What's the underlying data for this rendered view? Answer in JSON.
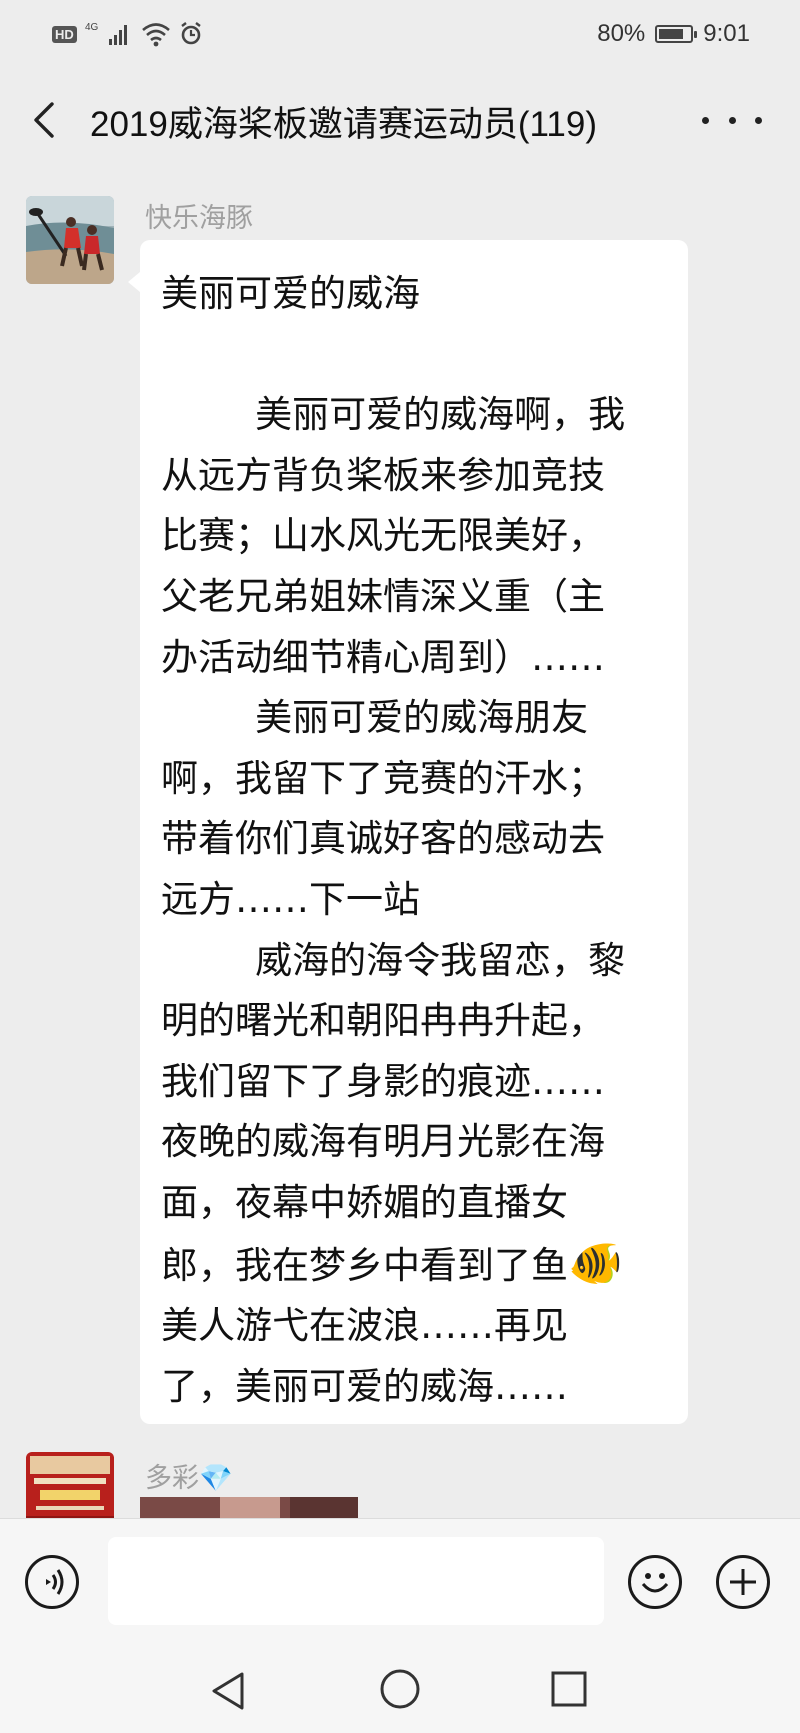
{
  "status_bar": {
    "hd_badge": "HD",
    "network": "4G",
    "battery_level": "80%",
    "battery_fraction": 0.8,
    "time": "9:01"
  },
  "header": {
    "title": "2019威海桨板邀请赛运动员(119)",
    "back_icon": "chevron-left-icon",
    "more_icon": "more-dots-icon"
  },
  "messages": [
    {
      "sender": "快乐海豚",
      "text_before": "美丽可爱的威海\n\n        美丽可爱的威海啊，我从远方背负桨板来参加竞技比赛；山水风光无限美好，父老兄弟姐妹情深义重（主办活动细节精心周到）……\n        美丽可爱的威海朋友啊，我留下了竞赛的汗水；带着你们真诚好客的感动去远方……下一站\n        威海的海令我留恋，黎明的曙光和朝阳冉冉升起，我们留下了身影的痕迹……夜晚的威海有明月光影在海面，夜幕中娇媚的直播女郎，我在梦乡中看到了鱼",
      "emoji": "🐠",
      "text_after": "美人游弋在波浪……再见了，美丽可爱的威海……"
    },
    {
      "sender": "多彩",
      "sender_emoji": "💎"
    }
  ],
  "input_bar": {
    "voice_icon": "voice-icon",
    "emoji_icon": "smiley-icon",
    "add_icon": "plus-icon",
    "input_value": ""
  },
  "nav_bar": {
    "back_icon": "triangle-back-icon",
    "home_icon": "circle-home-icon",
    "recents_icon": "square-recents-icon"
  }
}
